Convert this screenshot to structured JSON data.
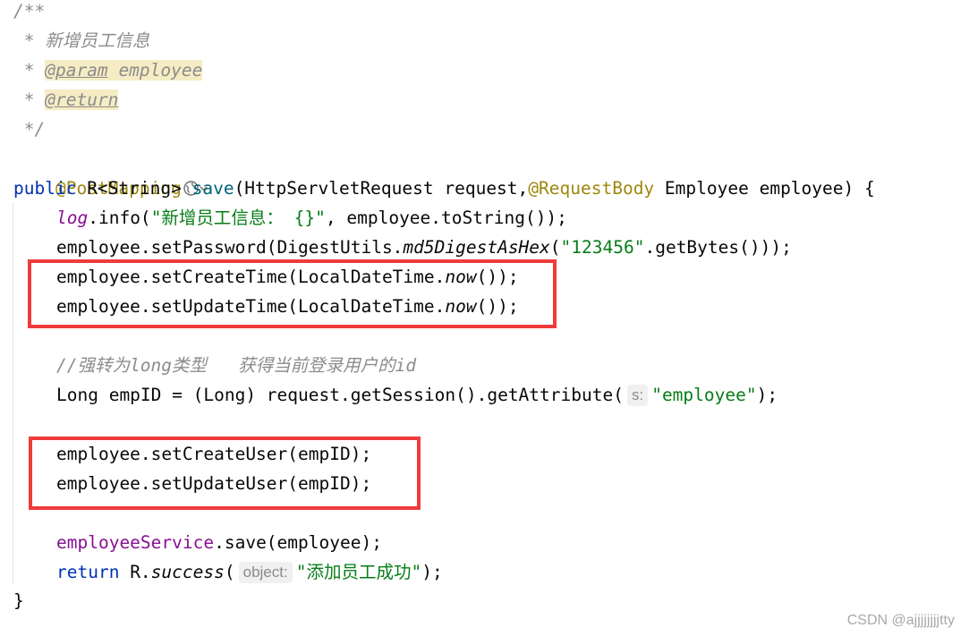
{
  "doc_comment": {
    "open": "/**",
    "line1_star": " * ",
    "line1_text": "新增员工信息",
    "line2_star": " * ",
    "param_tag": "@param",
    "param_name": "employee",
    "line3_star": " * ",
    "return_tag": "@return",
    "close": " */"
  },
  "annotation": {
    "text": "@PostMapping",
    "web_icon": "globe-icon",
    "dropdown_icon": "chevron-down-icon"
  },
  "signature": {
    "public": "public",
    "return_type": " R<String> ",
    "method_name": "save",
    "params_a": "(HttpServletRequest request,",
    "request_body": "@RequestBody",
    "params_b": " Employee employee) {"
  },
  "body": {
    "log_field": "log",
    "log_call": ".info(",
    "log_string": "\"新增员工信息： {}\"",
    "log_tail": ", employee.toString());",
    "pwd_a": "employee.setPassword(DigestUtils.",
    "pwd_method": "md5DigestAsHex",
    "pwd_b": "(",
    "pwd_string": "\"123456\"",
    "pwd_c": ".getBytes()));",
    "create_time_a": "employee.setCreateTime(LocalDateTime.",
    "create_time_now": "now",
    "create_time_b": "());",
    "update_time_a": "employee.setUpdateTime(LocalDateTime.",
    "update_time_now": "now",
    "update_time_b": "());",
    "comment_line": "//强转为long类型   获得当前登录用户的id",
    "emp_id_a": "Long empID = (Long) request.getSession().getAttribute(",
    "emp_id_hint": "s:",
    "emp_id_string": "\"employee\"",
    "emp_id_b": ");",
    "create_user": "employee.setCreateUser(empID);",
    "update_user": "employee.setUpdateUser(empID);",
    "service_field": "employeeService",
    "service_call": ".save(employee);",
    "return_kw": "return",
    "return_a": " R.",
    "return_method": "success",
    "return_b": "(",
    "return_hint": "object:",
    "return_string": "\"添加员工成功\"",
    "return_c": ");",
    "closing_brace": "}"
  },
  "highlight_color": "#ef3b3b",
  "watermark": "CSDN @ajjjjjjjjtty"
}
